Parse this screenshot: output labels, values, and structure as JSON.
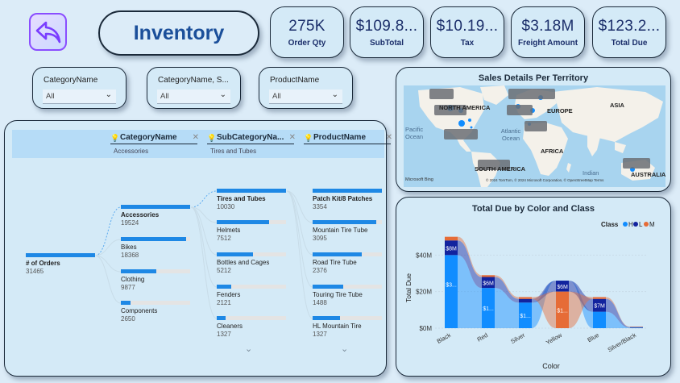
{
  "header": {
    "title": "Inventory"
  },
  "kpis": [
    {
      "value": "275K",
      "label": "Order Qty"
    },
    {
      "value": "$109.8...",
      "label": "SubTotal"
    },
    {
      "value": "$10.19...",
      "label": "Tax"
    },
    {
      "value": "$3.18M",
      "label": "Freight Amount"
    },
    {
      "value": "$123.2...",
      "label": "Total Due"
    }
  ],
  "slicers": [
    {
      "title": "CategoryName",
      "value": "All"
    },
    {
      "title": "CategoryName, S...",
      "value": "All"
    },
    {
      "title": "ProductName",
      "value": "All"
    }
  ],
  "tree": {
    "columns": [
      {
        "name": "CategoryName",
        "sub": "Accessories"
      },
      {
        "name": "SubCategoryNa...",
        "sub": "Tires and Tubes"
      },
      {
        "name": "ProductName",
        "sub": ""
      }
    ],
    "root": {
      "label": "# of Orders",
      "value": "31465",
      "fill": 1.0
    },
    "level1": [
      {
        "label": "Accessories",
        "value": "19524",
        "fill": 1.0
      },
      {
        "label": "Bikes",
        "value": "18368",
        "fill": 0.94
      },
      {
        "label": "Clothing",
        "value": "9877",
        "fill": 0.51
      },
      {
        "label": "Components",
        "value": "2650",
        "fill": 0.14
      }
    ],
    "level2": [
      {
        "label": "Tires and Tubes",
        "value": "10030",
        "fill": 1.0
      },
      {
        "label": "Helmets",
        "value": "7512",
        "fill": 0.75
      },
      {
        "label": "Bottles and Cages",
        "value": "5212",
        "fill": 0.52
      },
      {
        "label": "Fenders",
        "value": "2121",
        "fill": 0.21
      },
      {
        "label": "Cleaners",
        "value": "1327",
        "fill": 0.13
      }
    ],
    "level3": [
      {
        "label": "Patch Kit/8 Patches",
        "value": "3354",
        "fill": 1.0
      },
      {
        "label": "Mountain Tire Tube",
        "value": "3095",
        "fill": 0.92
      },
      {
        "label": "Road Tire Tube",
        "value": "2376",
        "fill": 0.71
      },
      {
        "label": "Touring Tire Tube",
        "value": "1488",
        "fill": 0.44
      },
      {
        "label": "HL Mountain Tire",
        "value": "1327",
        "fill": 0.4
      }
    ]
  },
  "map": {
    "title": "Sales Details Per Territory",
    "labels": {
      "north_america": "NORTH AMERICA",
      "europe": "EUROPE",
      "asia": "ASIA",
      "africa": "AFRICA",
      "south_america": "SOUTH AMERICA",
      "australia": "AUSTRALIA",
      "pacific": "Pacific Ocean",
      "atlantic": "Atlantic Ocean",
      "indian": "Indian",
      "bing": "Microsoft Bing",
      "copyright": "© 2024 TomTom, © 2024 Microsoft Corporation, © OpenStreetMap Terms"
    }
  },
  "chart_data": {
    "type": "ribbon",
    "title": "Total Due by Color and Class",
    "xlabel": "Color",
    "ylabel": "Total Due",
    "categories": [
      "Black",
      "Red",
      "Silver",
      "Yellow",
      "Blue",
      "Silver/Black"
    ],
    "yticks": [
      "$0M",
      "$20M",
      "$40M"
    ],
    "ylim": [
      0,
      45
    ],
    "legend": {
      "title": "Class",
      "position": "top-right"
    },
    "series": [
      {
        "name": "H",
        "color": "#118dff",
        "values": [
          40,
          22,
          14,
          0,
          9,
          0.3
        ]
      },
      {
        "name": "L",
        "color": "#12239e",
        "values": [
          8,
          6,
          2,
          6,
          7,
          0.3
        ]
      },
      {
        "name": "M",
        "color": "#e66c37",
        "values": [
          2,
          1,
          1,
          20,
          1,
          0.2
        ]
      }
    ],
    "data_labels": [
      "$3...",
      "$8M",
      "$1...",
      "$6M",
      "$1...",
      "$1...",
      "$6M",
      "$7M"
    ]
  },
  "colors": {
    "accent": "#1e88e5",
    "title": "#1b4f9a",
    "h": "#118dff",
    "l": "#12239e",
    "m": "#e66c37"
  }
}
